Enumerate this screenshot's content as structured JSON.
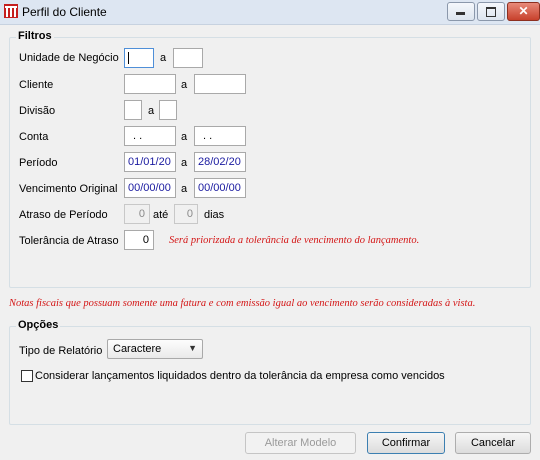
{
  "window": {
    "title": "Perfil do Cliente",
    "controls": {
      "minimize": "minimize",
      "maximize": "maximize",
      "close": "✕"
    }
  },
  "filtros": {
    "title": "Filtros",
    "connector_a": "a",
    "connector_ate": "até",
    "unidade_negocio": {
      "label": "Unidade de Negócio",
      "from": "",
      "to": ""
    },
    "cliente": {
      "label": "Cliente",
      "from": "",
      "to": ""
    },
    "divisao": {
      "label": "Divisão",
      "from": "",
      "to": ""
    },
    "conta": {
      "label": "Conta",
      "from": " .  .",
      "to": " .  ."
    },
    "periodo": {
      "label": "Período",
      "from": "01/01/20",
      "to": "28/02/20"
    },
    "vencimento_original": {
      "label": "Vencimento Original",
      "from": "00/00/00",
      "to": "00/00/00"
    },
    "atraso_periodo": {
      "label": "Atraso de Período",
      "from": "0",
      "to": "0",
      "unit": "dias"
    },
    "tolerancia_atraso": {
      "label": "Tolerância de Atraso",
      "value": "0",
      "note": "Será priorizada a tolerância de vencimento do lançamento."
    }
  },
  "notas_fiscais_note": "Notas fiscais que possuam somente uma fatura e com emissão igual ao vencimento serão consideradas à vista.",
  "opcoes": {
    "title": "Opções",
    "tipo_relatorio": {
      "label": "Tipo de Relatório",
      "selected": "Caractere"
    },
    "considerar": {
      "label": "Considerar lançamentos liquidados dentro da tolerância da empresa como vencidos",
      "checked": false
    }
  },
  "buttons": {
    "alterar_modelo": "Alterar Modelo",
    "confirmar": "Confirmar",
    "cancelar": "Cancelar"
  },
  "colors": {
    "note_red": "#d41616",
    "field_text": "#1a1aa0"
  }
}
